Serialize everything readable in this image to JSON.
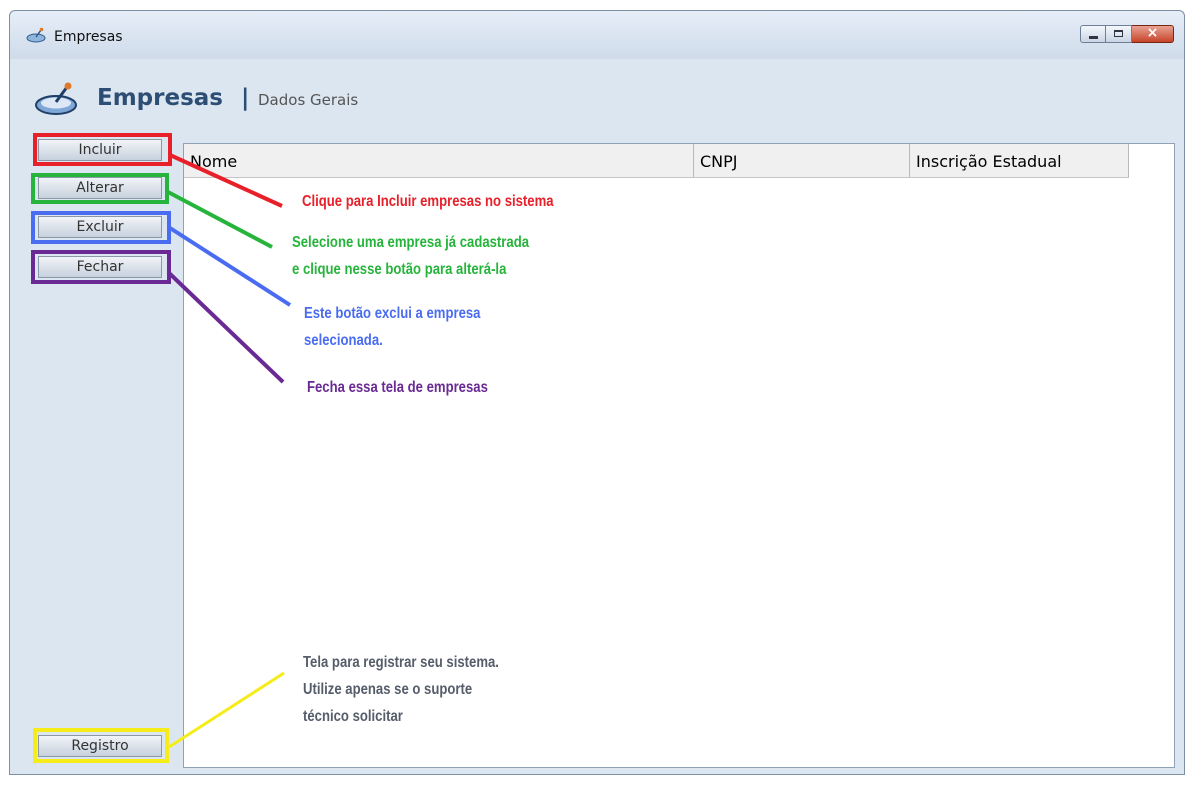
{
  "window": {
    "title": "Empresas",
    "controls": {
      "close_glyph": "×"
    }
  },
  "header": {
    "title": "Empresas",
    "separator": "|",
    "subtitle": "Dados Gerais"
  },
  "sidebar": {
    "buttons": [
      {
        "label": "Incluir"
      },
      {
        "label": "Alterar"
      },
      {
        "label": "Excluir"
      },
      {
        "label": "Fechar"
      }
    ],
    "registro_label": "Registro"
  },
  "grid": {
    "columns": [
      "Nome",
      "CNPJ",
      "Inscrição Estadual"
    ]
  },
  "annotations": {
    "incluir": {
      "color": "#e8202a",
      "lines": [
        "Clique para Incluir empresas no sistema"
      ]
    },
    "alterar": {
      "color": "#27b43c",
      "lines": [
        "Selecione uma empresa já cadastrada",
        "e clique nesse botão para alterá-la"
      ]
    },
    "excluir": {
      "color": "#4a6cf0",
      "lines": [
        "Este botão exclui a empresa",
        "selecionada."
      ]
    },
    "fechar": {
      "color": "#6a2a94",
      "lines": [
        "Fecha essa tela de empresas"
      ]
    },
    "registro": {
      "color": "#565d6a",
      "lines": [
        "Tela para registrar seu sistema.",
        "Utilize apenas se o suporte",
        "técnico solicitar"
      ]
    }
  },
  "colors": {
    "highlight_incluir": "#e8202a",
    "highlight_alterar": "#27b43c",
    "highlight_excluir": "#4a6cf0",
    "highlight_fechar": "#6a2a94",
    "highlight_registro": "#f5ec1a"
  },
  "icons": {
    "window_icon": "satellite-dish-icon",
    "header_icon": "satellite-dish-icon"
  }
}
